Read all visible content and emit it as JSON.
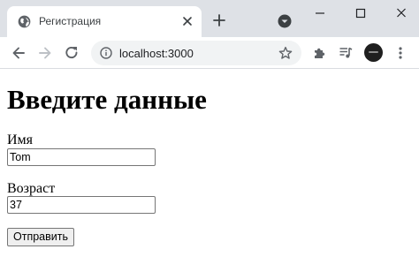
{
  "browser": {
    "tab_title": "Регистрация",
    "url": "localhost:3000",
    "icons": {
      "favicon": "globe-icon",
      "tab_close": "close-icon",
      "new_tab": "plus-icon",
      "tab_search": "chevron-down-icon",
      "minimize": "minimize-icon",
      "maximize": "maximize-icon",
      "close_window": "close-icon",
      "back": "arrow-left-icon",
      "forward": "arrow-right-icon",
      "reload": "reload-icon",
      "site_info": "info-icon",
      "bookmark": "star-icon",
      "extensions": "puzzle-icon",
      "media": "media-control-icon",
      "profile": "avatar",
      "menu": "kebab-menu-icon"
    },
    "colors": {
      "tabstrip_bg": "#dee1e6",
      "omnibox_bg": "#f1f3f4"
    }
  },
  "page": {
    "heading": "Введите данные",
    "form": {
      "name_label": "Имя",
      "name_value": "Tom",
      "age_label": "Возраст",
      "age_value": "37",
      "submit_label": "Отправить"
    }
  }
}
